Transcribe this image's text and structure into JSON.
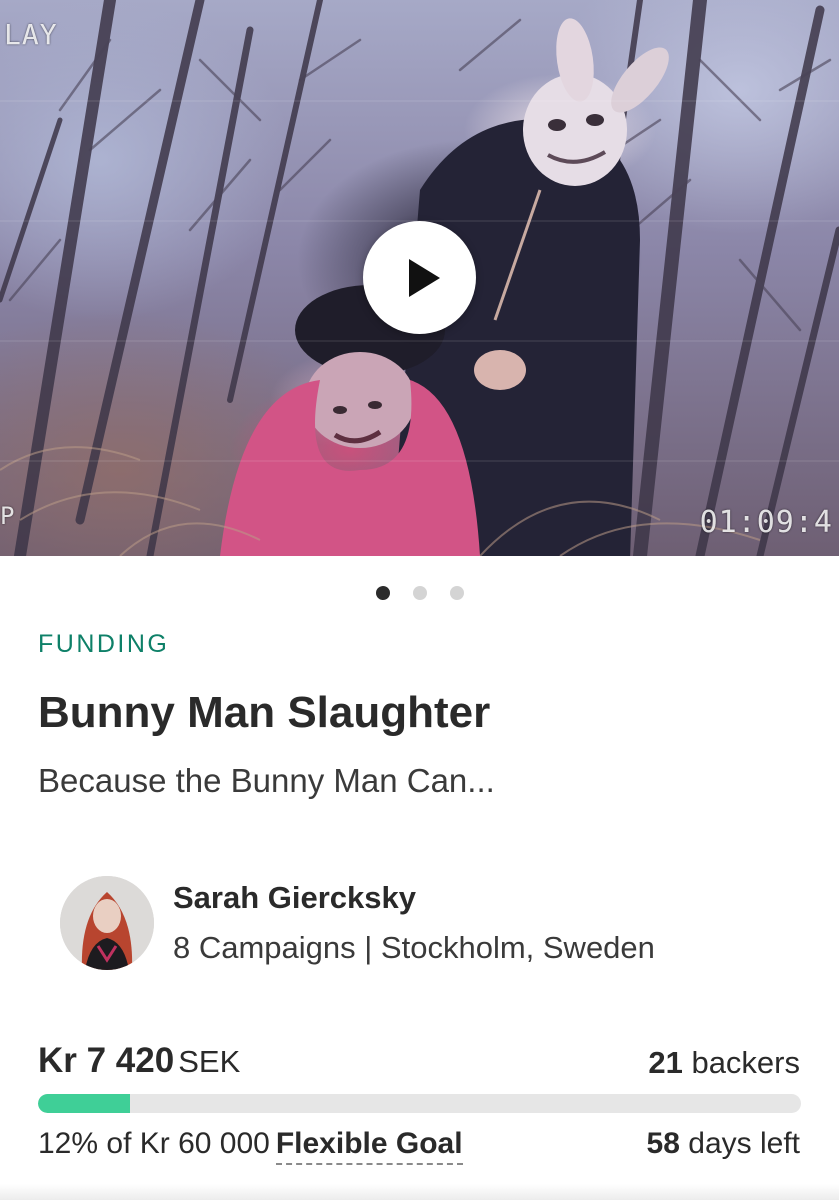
{
  "hero": {
    "osd_top_left": "LAY",
    "osd_bottom_left": "P",
    "osd_timecode": "01:09:4",
    "play_icon": "play-icon"
  },
  "carousel": {
    "count": 3,
    "active_index": 0
  },
  "campaign": {
    "category": "FUNDING",
    "title": "Bunny Man Slaughter",
    "tagline": "Because the Bunny Man Can..."
  },
  "owner": {
    "name": "Sarah Giercksky",
    "meta": "8 Campaigns | Stockholm, Sweden",
    "avatar_icon": "avatar"
  },
  "funding": {
    "raised_amount": "Kr 7 420",
    "raised_currency": "SEK",
    "backers_count": "21",
    "backers_label": "backers",
    "progress_percent": 12,
    "goal_text": "12% of Kr 60 000",
    "goal_type": "Flexible Goal",
    "days_count": "58",
    "days_label": "days left"
  },
  "colors": {
    "category": "#0e8068",
    "progress_fill": "#3fcf97",
    "progress_track": "#e6e6e6"
  }
}
